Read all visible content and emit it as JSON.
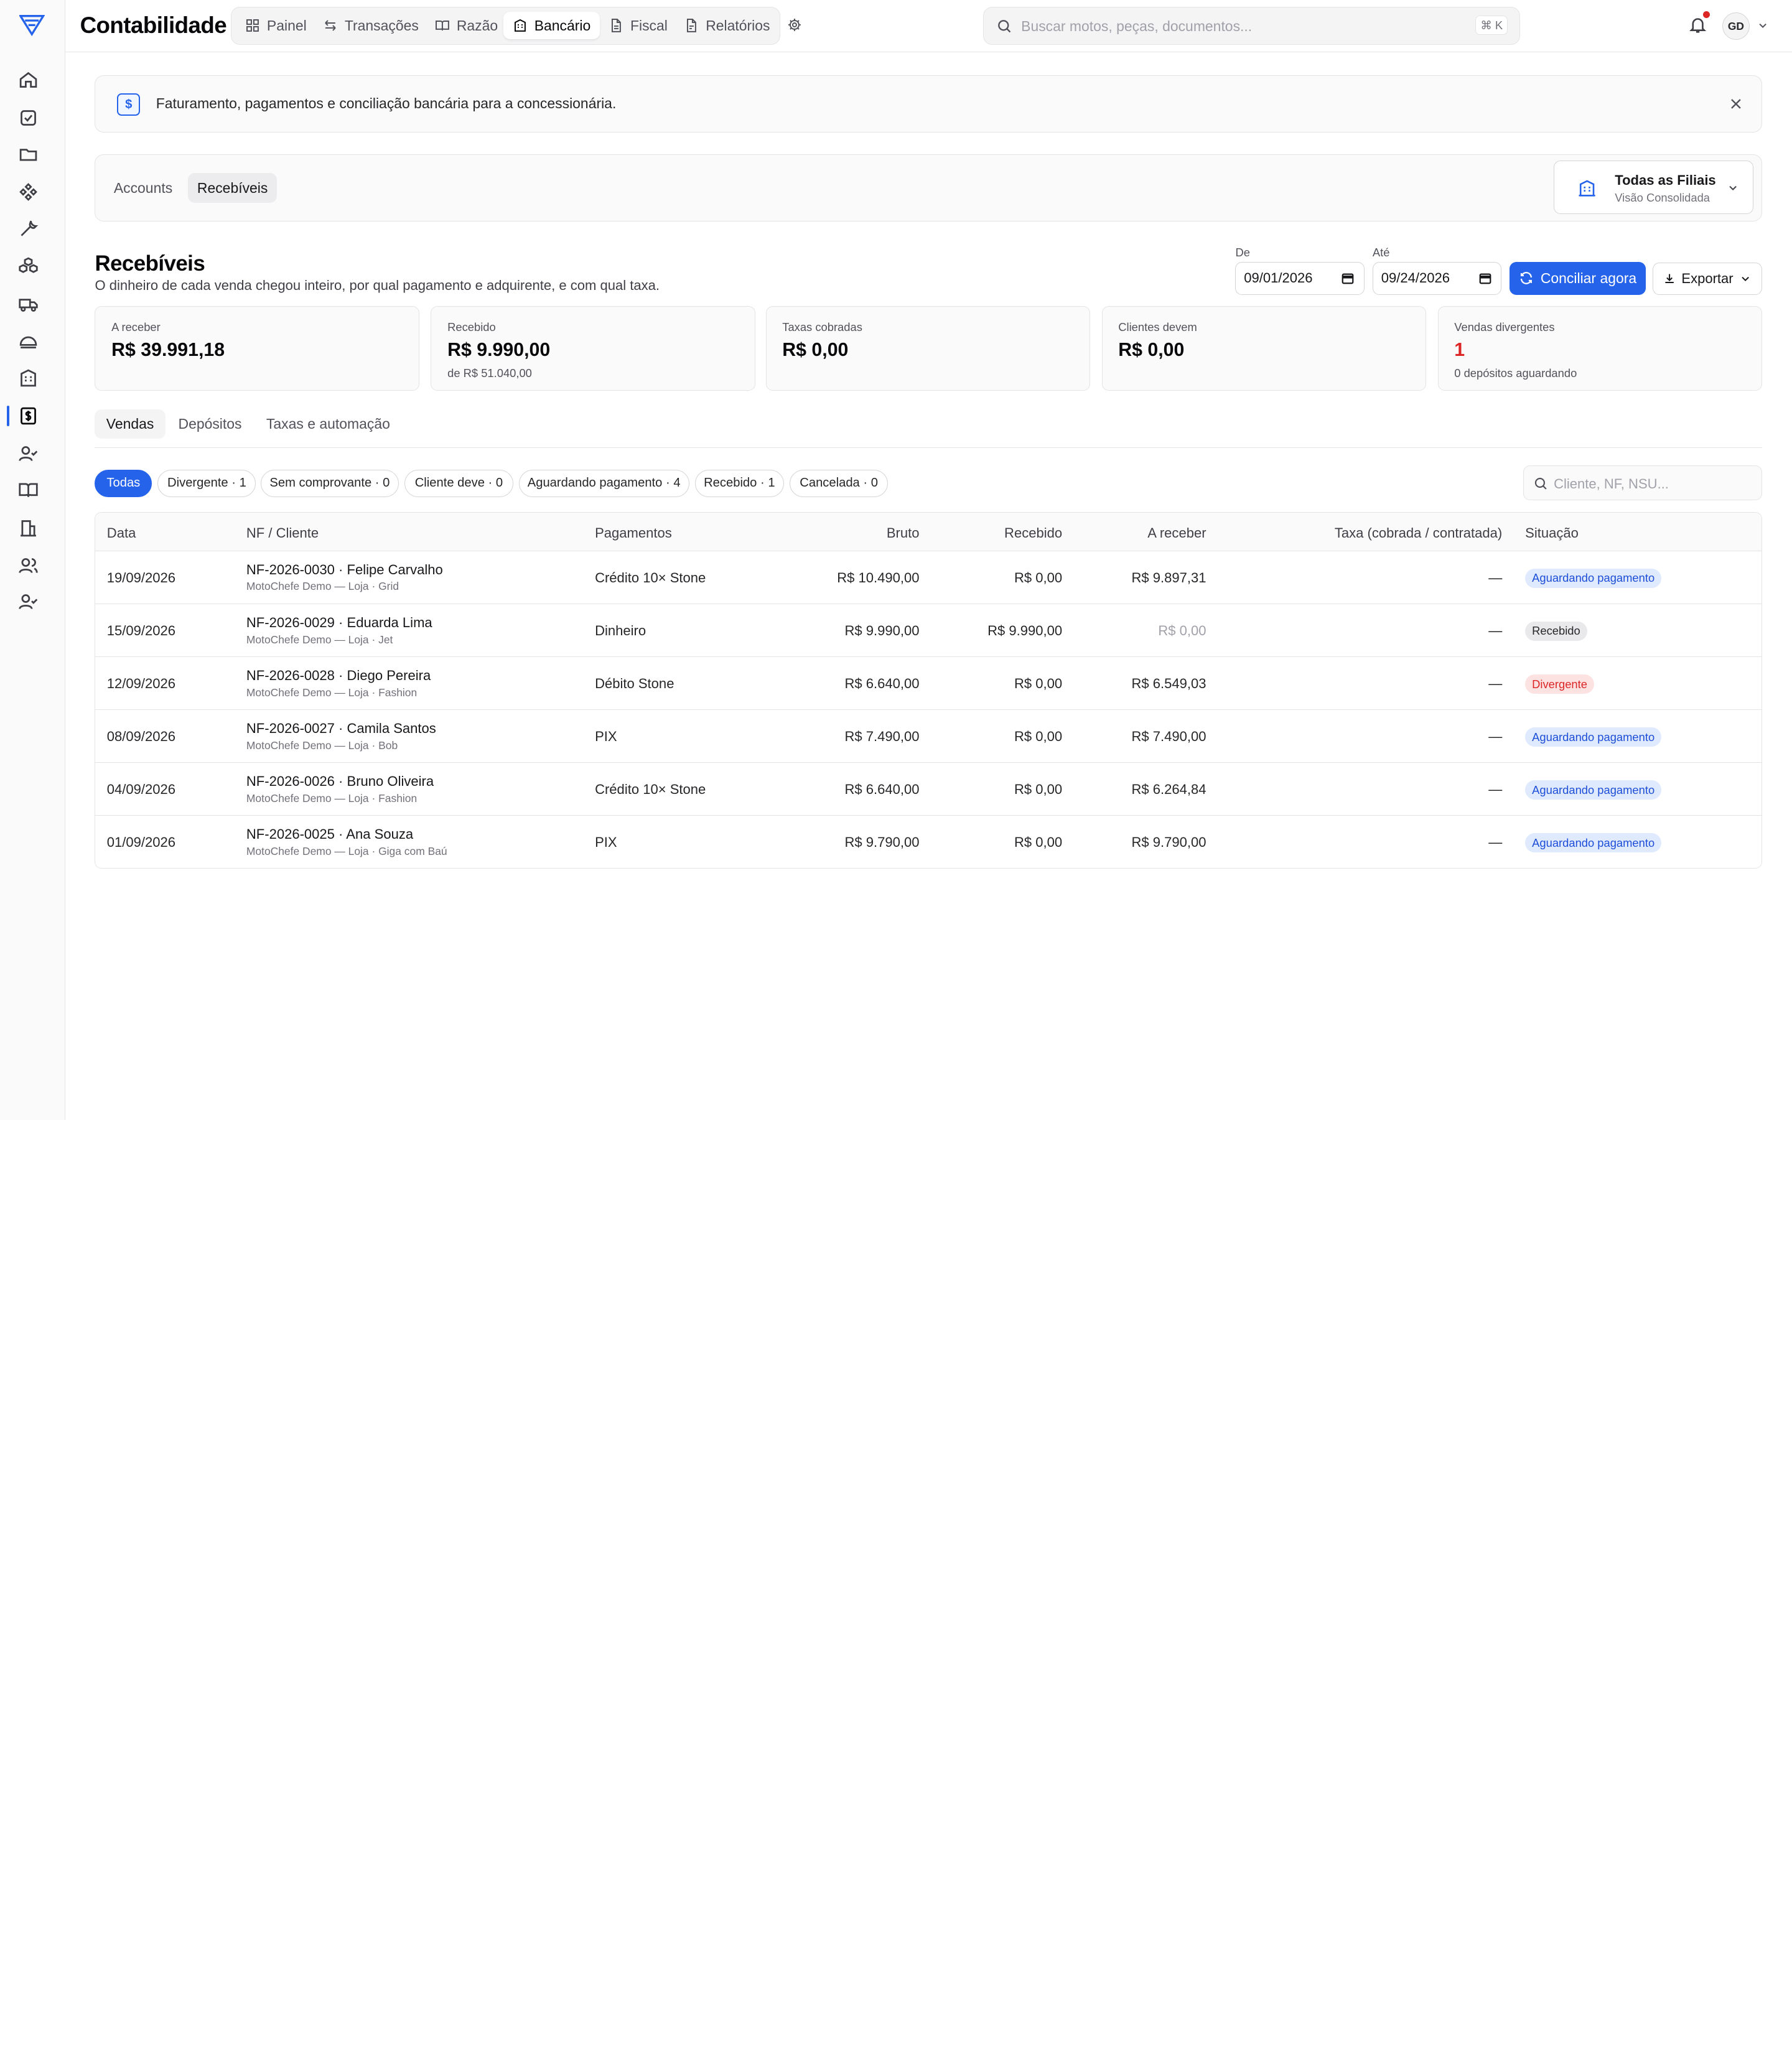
{
  "app": {
    "title": "Contabilidade"
  },
  "nav": {
    "tabs": [
      {
        "label": "Painel",
        "icon": "grid-icon"
      },
      {
        "label": "Transações",
        "icon": "arrows-icon"
      },
      {
        "label": "Razão",
        "icon": "book-icon"
      },
      {
        "label": "Bancário",
        "icon": "bank-icon",
        "active": true
      },
      {
        "label": "Fiscal",
        "icon": "file-icon"
      },
      {
        "label": "Relatórios",
        "icon": "report-icon"
      }
    ]
  },
  "search": {
    "placeholder": "Buscar motos, peças, documentos...",
    "shortcut": "⌘ K"
  },
  "user": {
    "initials": "GD"
  },
  "banner": {
    "text": "Faturamento, pagamentos e conciliação bancária para a concessionária."
  },
  "subnav": {
    "tabs": [
      {
        "label": "Accounts"
      },
      {
        "label": "Recebíveis",
        "active": true
      }
    ],
    "branch": {
      "title": "Todas as Filiais",
      "subtitle": "Visão Consolidada"
    }
  },
  "page": {
    "title": "Recebíveis",
    "subtitle": "O dinheiro de cada venda chegou inteiro, por qual pagamento e adquirente, e com qual taxa.",
    "from_label": "De",
    "from_value": "09/01/2026",
    "to_label": "Até",
    "to_value": "09/24/2026",
    "reconcile_label": "Conciliar agora",
    "export_label": "Exportar"
  },
  "stats": [
    {
      "label": "A receber",
      "value": "R$ 39.991,18",
      "sub": ""
    },
    {
      "label": "Recebido",
      "value": "R$ 9.990,00",
      "sub": "de R$ 51.040,00"
    },
    {
      "label": "Taxas cobradas",
      "value": "R$ 0,00",
      "sub": ""
    },
    {
      "label": "Clientes devem",
      "value": "R$ 0,00",
      "sub": ""
    },
    {
      "label": "Vendas divergentes",
      "value": "1",
      "sub": "0 depósitos aguardando"
    }
  ],
  "content_tabs": [
    {
      "label": "Vendas",
      "active": true
    },
    {
      "label": "Depósitos"
    },
    {
      "label": "Taxas e automação"
    }
  ],
  "filters": [
    {
      "label": "Todas",
      "active": true
    },
    {
      "label": "Divergente · 1"
    },
    {
      "label": "Sem comprovante · 0"
    },
    {
      "label": "Cliente deve · 0"
    },
    {
      "label": "Aguardando pagamento · 4"
    },
    {
      "label": "Recebido · 1"
    },
    {
      "label": "Cancelada · 0"
    }
  ],
  "table_search": {
    "placeholder": "Cliente, NF, NSU..."
  },
  "table": {
    "headers": [
      "Data",
      "NF / Cliente",
      "Pagamentos",
      "Bruto",
      "Recebido",
      "A receber",
      "Taxa (cobrada / contratada)",
      "Situação"
    ],
    "rows": [
      {
        "date": "19/09/2026",
        "nf": "NF-2026-0030 · Felipe Carvalho",
        "store": "MotoChefe Demo — Loja · Grid",
        "payment": "Crédito 10× Stone",
        "gross": "R$ 10.490,00",
        "received": "R$ 0,00",
        "due": "R$ 9.897,31",
        "fee": "—",
        "status": "Aguardando pagamento",
        "status_kind": "blue"
      },
      {
        "date": "15/09/2026",
        "nf": "NF-2026-0029 · Eduarda Lima",
        "store": "MotoChefe Demo — Loja · Jet",
        "payment": "Dinheiro",
        "gross": "R$ 9.990,00",
        "received": "R$ 9.990,00",
        "due": "R$ 0,00",
        "fee": "—",
        "status": "Recebido",
        "status_kind": "gray"
      },
      {
        "date": "12/09/2026",
        "nf": "NF-2026-0028 · Diego Pereira",
        "store": "MotoChefe Demo — Loja · Fashion",
        "payment": "Débito Stone",
        "gross": "R$ 6.640,00",
        "received": "R$ 0,00",
        "due": "R$ 6.549,03",
        "fee": "—",
        "status": "Divergente",
        "status_kind": "red"
      },
      {
        "date": "08/09/2026",
        "nf": "NF-2026-0027 · Camila Santos",
        "store": "MotoChefe Demo — Loja · Bob",
        "payment": "PIX",
        "gross": "R$ 7.490,00",
        "received": "R$ 0,00",
        "due": "R$ 7.490,00",
        "fee": "—",
        "status": "Aguardando pagamento",
        "status_kind": "blue"
      },
      {
        "date": "04/09/2026",
        "nf": "NF-2026-0026 · Bruno Oliveira",
        "store": "MotoChefe Demo — Loja · Fashion",
        "payment": "Crédito 10× Stone",
        "gross": "R$ 6.640,00",
        "received": "R$ 0,00",
        "due": "R$ 6.264,84",
        "fee": "—",
        "status": "Aguardando pagamento",
        "status_kind": "blue"
      },
      {
        "date": "01/09/2026",
        "nf": "NF-2026-0025 · Ana Souza",
        "store": "MotoChefe Demo — Loja · Giga com Baú",
        "payment": "PIX",
        "gross": "R$ 9.790,00",
        "received": "R$ 0,00",
        "due": "R$ 9.790,00",
        "fee": "—",
        "status": "Aguardando pagamento",
        "status_kind": "blue"
      }
    ]
  },
  "colors": {
    "accent": "#2563eb",
    "danger": "#dc2626",
    "border": "#e4e4e7"
  }
}
